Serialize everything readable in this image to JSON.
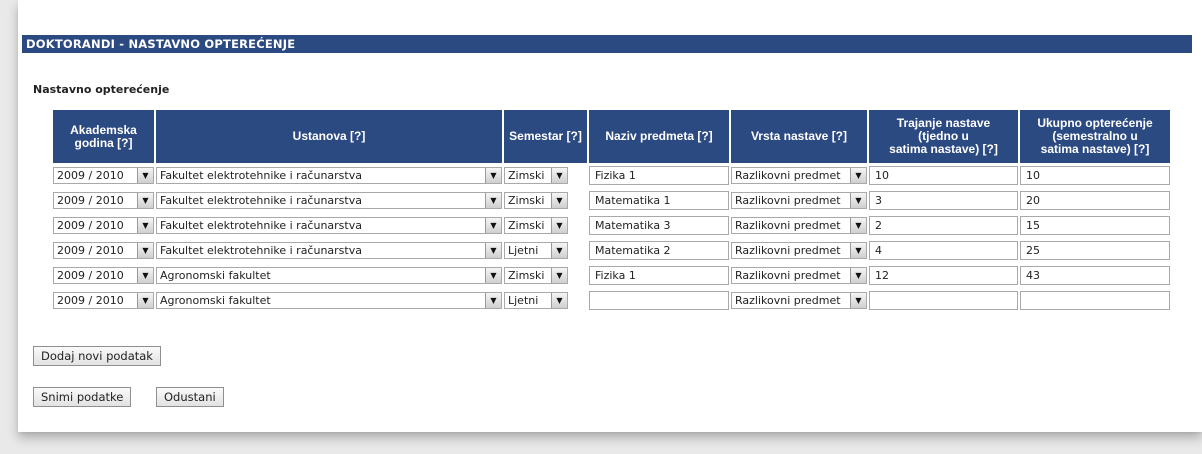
{
  "header": {
    "title": "DOKTORANDI - NASTAVNO OPTEREĆENJE"
  },
  "section": {
    "title": "Nastavno opterećenje"
  },
  "columns": [
    {
      "label": "Akademska godina [?]"
    },
    {
      "label": "Ustanova [?]"
    },
    {
      "label": "Semestar [?]"
    },
    {
      "label": "Naziv predmeta [?]"
    },
    {
      "label": "Vrsta nastave [?]"
    },
    {
      "label": "Trajanje nastave (tjedno u satima nastave) [?]"
    },
    {
      "label": "Ukupno opterećenje (semestralno u satima nastave) [?]"
    }
  ],
  "rows": [
    {
      "year": "2009 / 2010",
      "institution": "Fakultet elektrotehnike i računarstva",
      "semester": "Zimski",
      "course": "Fizika 1",
      "type": "Razlikovni predmet",
      "weekly": "10",
      "total": "10"
    },
    {
      "year": "2009 / 2010",
      "institution": "Fakultet elektrotehnike i računarstva",
      "semester": "Zimski",
      "course": "Matematika 1",
      "type": "Razlikovni predmet",
      "weekly": "3",
      "total": "20"
    },
    {
      "year": "2009 / 2010",
      "institution": "Fakultet elektrotehnike i računarstva",
      "semester": "Zimski",
      "course": "Matematika 3",
      "type": "Razlikovni predmet",
      "weekly": "2",
      "total": "15"
    },
    {
      "year": "2009 / 2010",
      "institution": "Fakultet elektrotehnike i računarstva",
      "semester": "Ljetni",
      "course": "Matematika 2",
      "type": "Razlikovni predmet",
      "weekly": "4",
      "total": "25"
    },
    {
      "year": "2009 / 2010",
      "institution": "Agronomski fakultet",
      "semester": "Zimski",
      "course": "Fizika 1",
      "type": "Razlikovni predmet",
      "weekly": "12",
      "total": "43"
    },
    {
      "year": "2009 / 2010",
      "institution": "Agronomski fakultet",
      "semester": "Ljetni",
      "course": "",
      "type": "Razlikovni predmet",
      "weekly": "",
      "total": ""
    }
  ],
  "buttons": {
    "add": "Dodaj novi podatak",
    "save": "Snimi podatke",
    "cancel": "Odustani"
  },
  "icons": {
    "dropdown": "chevron-down-icon"
  },
  "colors": {
    "header_bg": "#2c4a82",
    "header_text": "#ffffff"
  }
}
